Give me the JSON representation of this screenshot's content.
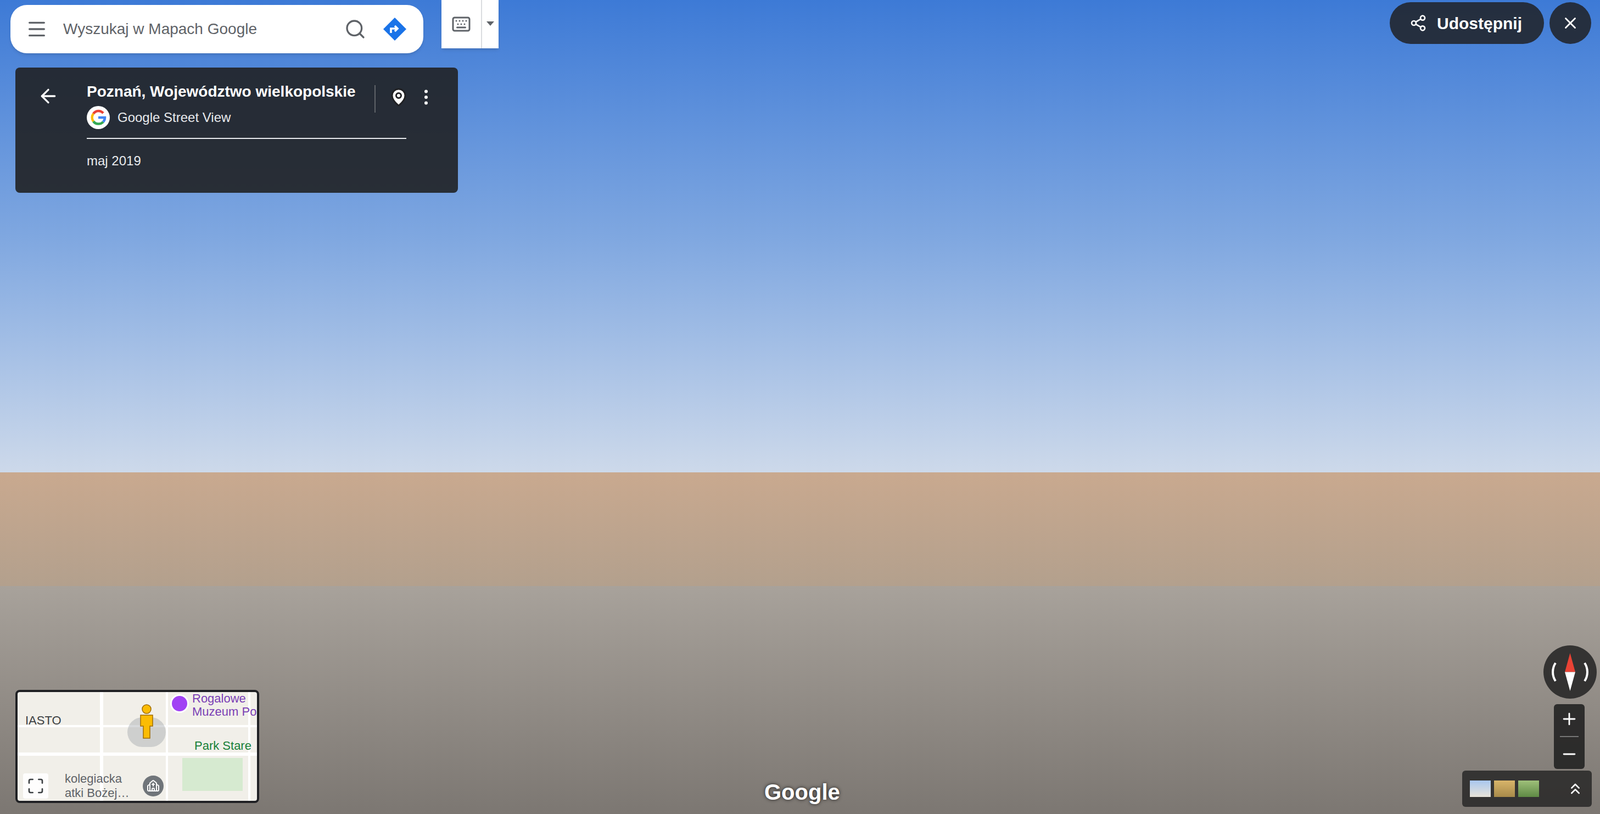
{
  "search": {
    "placeholder": "Wyszukaj w Mapach Google"
  },
  "location_card": {
    "title": "Poznań, Województwo wielkopolskie",
    "source": "Google Street View",
    "date": "maj 2019"
  },
  "share_button": {
    "label": "Udostępnij"
  },
  "minimap": {
    "labels": [
      {
        "text": "Rogalowe",
        "color": "#7b3fb5"
      },
      {
        "text": "Muzeum Po",
        "color": "#7b3fb5"
      },
      {
        "text": "IASTO",
        "color": "#3c4043"
      },
      {
        "text": "Park Stare",
        "color": "#188038"
      },
      {
        "text": "kolegiacka",
        "color": "#5f6368"
      },
      {
        "text": "atki Bożej…",
        "color": "#5f6368"
      }
    ]
  },
  "watermark": "Google"
}
